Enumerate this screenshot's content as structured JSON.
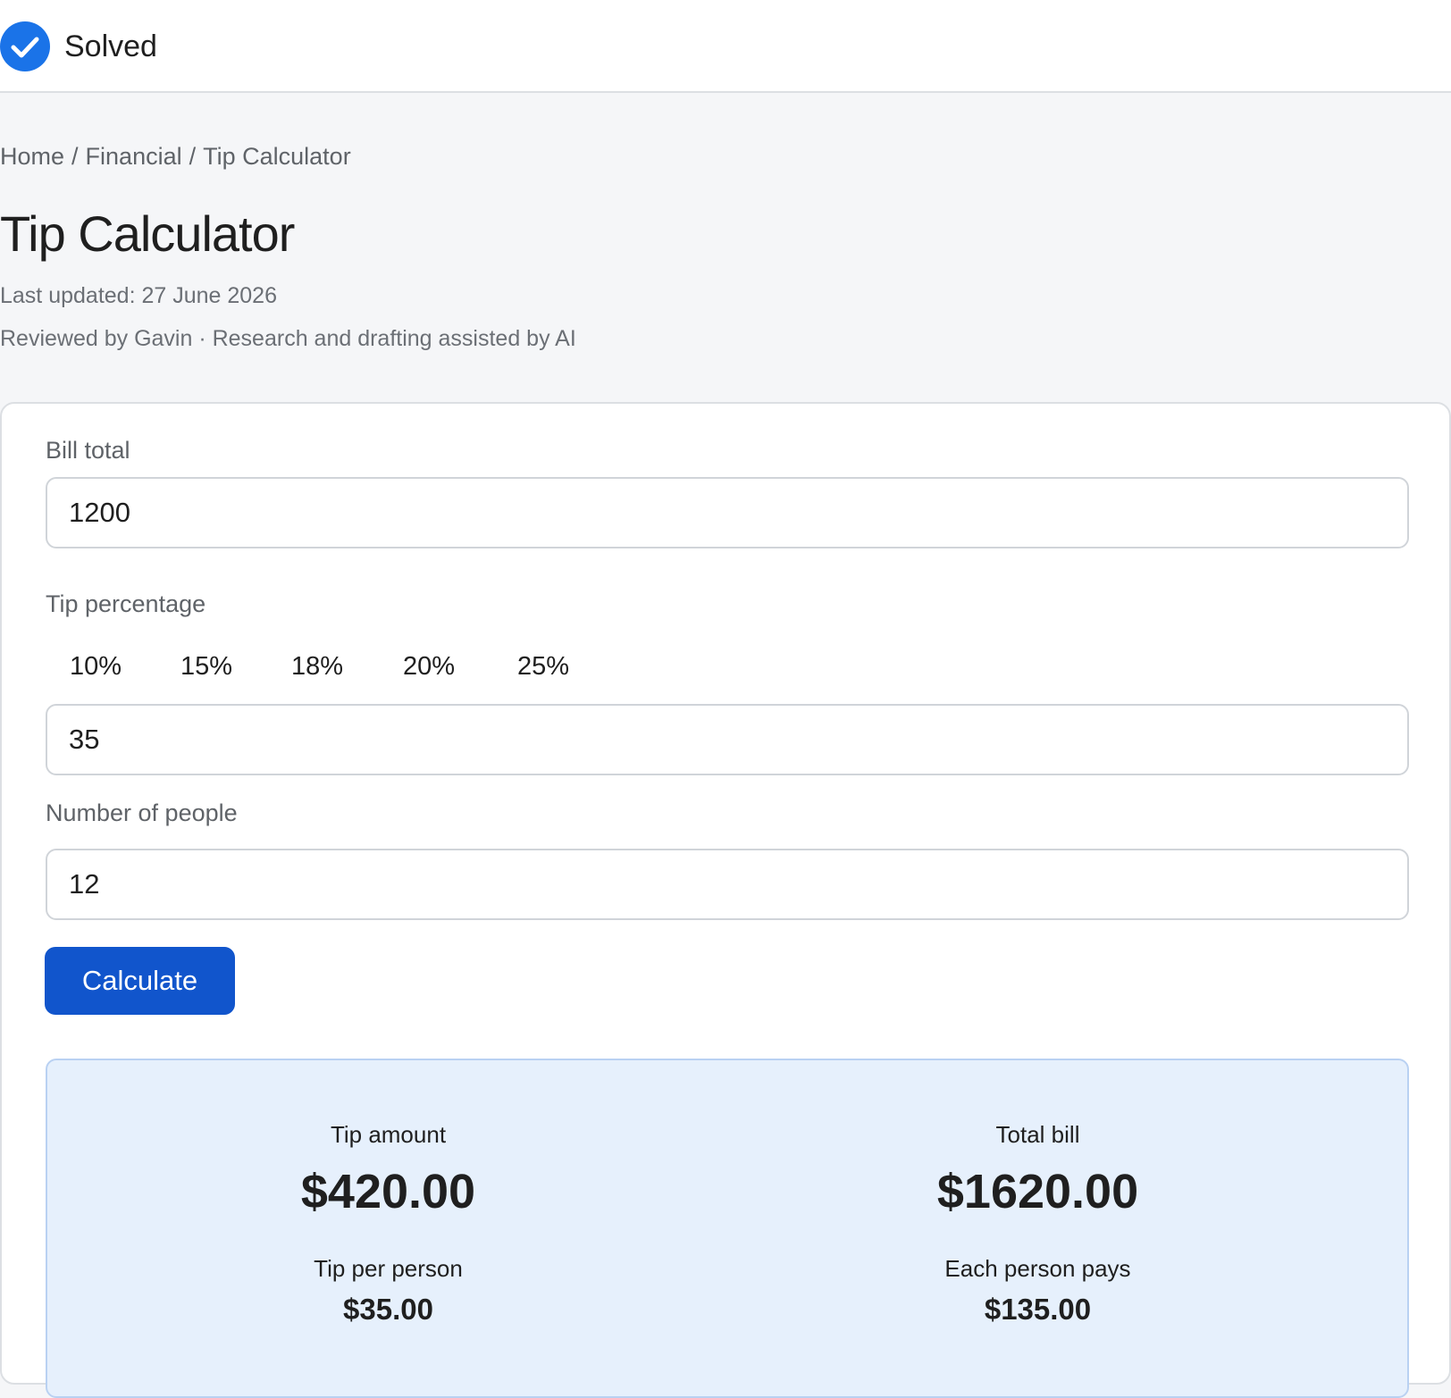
{
  "status": {
    "icon": "check-circle-icon",
    "label": "Solved",
    "accent_color": "#1a73e8"
  },
  "breadcrumb": [
    "Home",
    "Financial",
    "Tip Calculator"
  ],
  "page": {
    "title": "Tip Calculator",
    "last_updated": "Last updated: 27 June 2026",
    "reviewed": "Reviewed by Gavin · Research and drafting assisted by AI"
  },
  "form": {
    "bill_label": "Bill total",
    "bill_value": "1200",
    "tip_label": "Tip percentage",
    "tip_presets": [
      "10%",
      "15%",
      "18%",
      "20%",
      "25%"
    ],
    "tip_value": "35",
    "people_label": "Number of people",
    "people_value": "12",
    "calculate_label": "Calculate",
    "button_color": "#1155cc"
  },
  "results": {
    "tip_amount_label": "Tip amount",
    "tip_amount": "$420.00",
    "total_bill_label": "Total bill",
    "total_bill": "$1620.00",
    "tip_per_person_label": "Tip per person",
    "tip_per_person": "$35.00",
    "each_pays_label": "Each person pays",
    "each_pays": "$135.00",
    "panel_color": "#e6f0fc"
  }
}
